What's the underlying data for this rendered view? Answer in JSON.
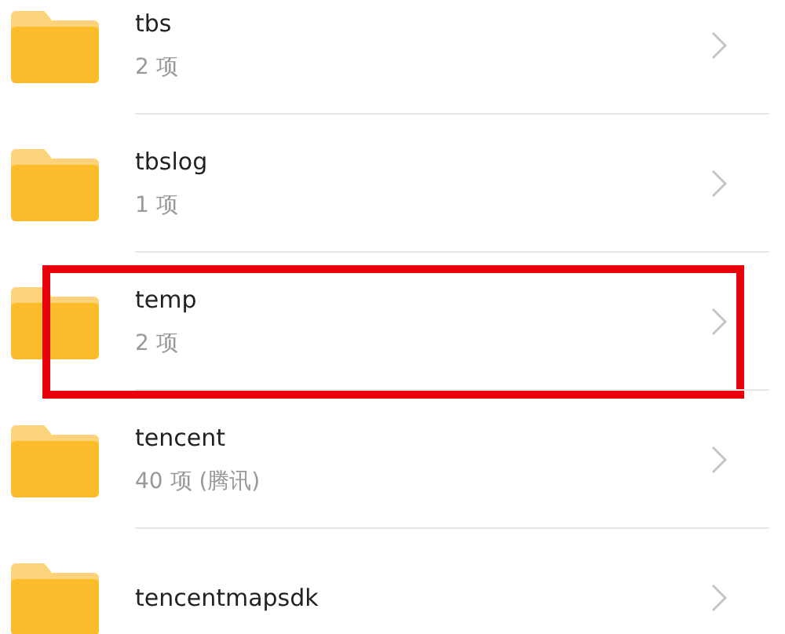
{
  "folders": [
    {
      "name": "tbs",
      "count": "2 项",
      "highlighted": false
    },
    {
      "name": "tbslog",
      "count": "1 项",
      "highlighted": false
    },
    {
      "name": "temp",
      "count": "2 项",
      "highlighted": true
    },
    {
      "name": "tencent",
      "count": "40 项 (腾讯)",
      "highlighted": false
    },
    {
      "name": "tencentmapsdk",
      "highlighted": false
    }
  ]
}
